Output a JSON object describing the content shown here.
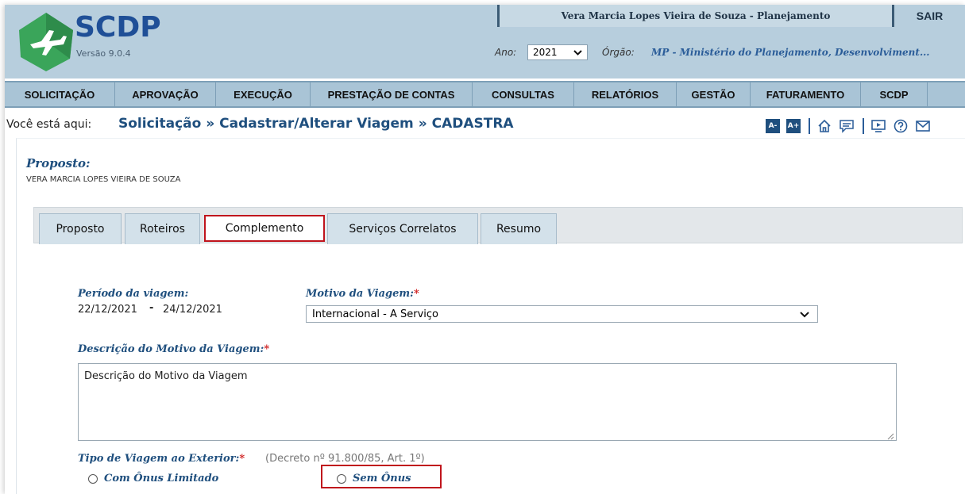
{
  "header": {
    "app_name": "SCDP",
    "version": "Versão 9.0.4",
    "user_info": "Vera Marcia Lopes Vieira de Souza - Planejamento",
    "sair_label": "SAIR",
    "ano_label": "Ano:",
    "ano_value": "2021",
    "orgao_label": "Órgão:",
    "orgao_value": "MP - Ministério do Planejamento, Desenvolviment..."
  },
  "menu": {
    "items": [
      {
        "label": "SOLICITAÇÃO"
      },
      {
        "label": "APROVAÇÃO"
      },
      {
        "label": "EXECUÇÃO"
      },
      {
        "label": "PRESTAÇÃO DE CONTAS"
      },
      {
        "label": "CONSULTAS"
      },
      {
        "label": "RELATÓRIOS"
      },
      {
        "label": "GESTÃO"
      },
      {
        "label": "FATURAMENTO"
      },
      {
        "label": "SCDP"
      }
    ]
  },
  "breadcrumb": {
    "label": "Você está aqui:",
    "path": "Solicitação » Cadastrar/Alterar Viagem » CADASTRA",
    "font_minus": "A-",
    "font_plus": "A+"
  },
  "proposto": {
    "heading": "Proposto:",
    "name": "VERA MARCIA LOPES VIEIRA DE SOUZA"
  },
  "tabs": [
    {
      "label": "Proposto"
    },
    {
      "label": "Roteiros"
    },
    {
      "label": "Complemento",
      "active": true
    },
    {
      "label": "Serviços Correlatos"
    },
    {
      "label": "Resumo"
    }
  ],
  "form": {
    "periodo_label": "Período da viagem:",
    "periodo_start": "22/12/2021",
    "periodo_sep": "-",
    "periodo_end": "24/12/2021",
    "motivo_label": "Motivo da Viagem:",
    "motivo_value": "Internacional - A Serviço",
    "descricao_label": "Descrição do Motivo da Viagem:",
    "descricao_value": "Descrição do Motivo da Viagem",
    "tipo_label": "Tipo de Viagem ao Exterior:",
    "tipo_hint": "(Decreto nº 91.800/85, Art. 1º)",
    "required_mark": "*",
    "option_com": "Com Ônus Limitado",
    "option_sem": "Sem Ônus"
  },
  "colors": {
    "header_bg": "#b7cedd",
    "menu_bg": "#a9c4d6",
    "brand_blue": "#1f4f97",
    "label_blue": "#1f4f7e",
    "highlight_red": "#c0141c",
    "logo_green": "#3aa55a"
  }
}
